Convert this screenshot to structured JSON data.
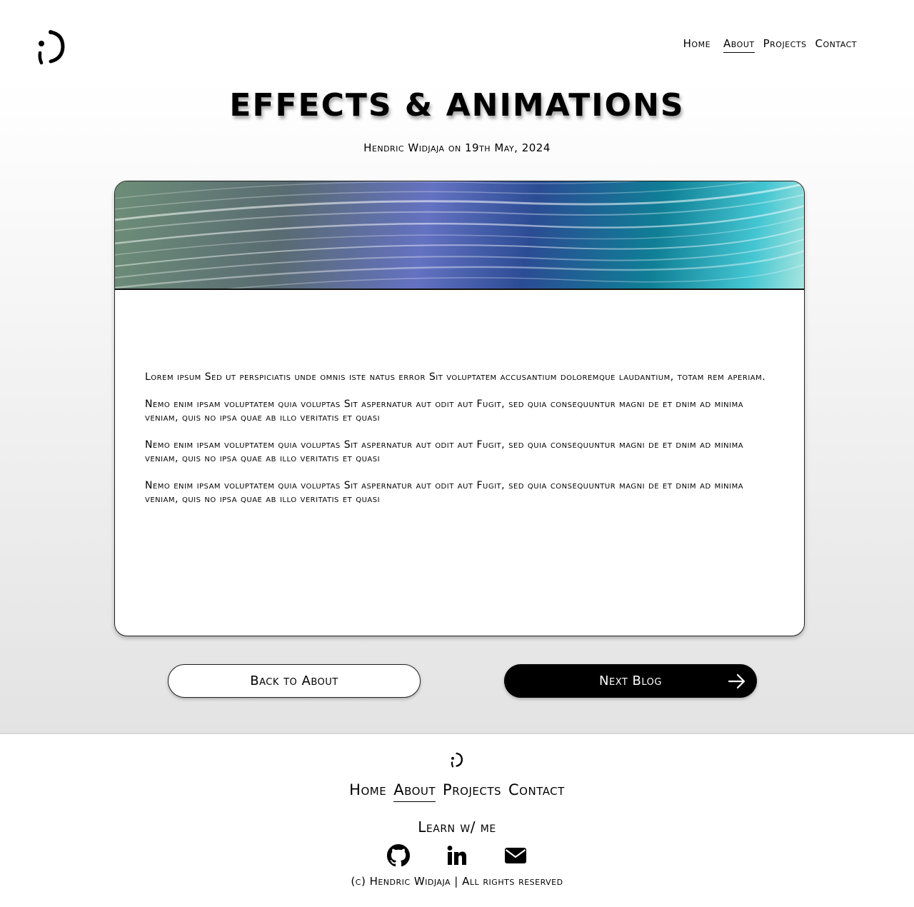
{
  "header": {
    "logo_icon": "winking-face-logo-icon",
    "nav": [
      {
        "label": "Home",
        "active": false
      },
      {
        "label": "About",
        "active": true
      },
      {
        "label": "Projects",
        "active": false
      },
      {
        "label": "Contact",
        "active": false
      }
    ]
  },
  "post": {
    "title": "EFFECTS & ANIMATIONS",
    "byline": "Hendric Widjaja on 19th May, 2024",
    "hero_icon": "abstract-waves-banner",
    "paragraphs": [
      "Lorem ipsum Sed ut perspiciatis unde omnis iste natus error Sit voluptatem accusantium doloremque laudantium, totam rem aperiam.",
      " Nemo enim ipsam voluptatem quia voluptas Sit aspernatur aut odit aut Fugit, sed quia consequuntur magni de et dnim ad minima veniam, quis no ipsa quae ab illo  veritatis et quasi",
      " Nemo enim ipsam voluptatem quia voluptas Sit aspernatur aut odit aut Fugit, sed quia consequuntur magni de et dnim ad minima veniam, quis no ipsa quae ab illo  veritatis et quasi",
      " Nemo enim ipsam voluptatem quia voluptas Sit aspernatur aut odit aut Fugit, sed quia consequuntur magni de et dnim ad minima veniam, quis no ipsa quae ab illo  veritatis et quasi"
    ]
  },
  "buttons": {
    "back_label": "Back to About",
    "next_label": "Next Blog",
    "next_icon": "arrow-right-icon"
  },
  "footer": {
    "logo_icon": "winking-face-logo-icon",
    "nav": [
      {
        "label": "Home",
        "active": false
      },
      {
        "label": "About",
        "active": true
      },
      {
        "label": "Projects",
        "active": false
      },
      {
        "label": "Contact",
        "active": false
      }
    ],
    "learn_label": "Learn w/ me",
    "socials": [
      "github-icon",
      "linkedin-icon",
      "envelope-icon"
    ],
    "copyright": "(c) Hendric Widjaja | All rights reserved"
  },
  "colors": {
    "text": "#000000",
    "background_top": "#ffffff",
    "background_bottom": "#e3e3e3",
    "next_button_bg": "#000000"
  }
}
